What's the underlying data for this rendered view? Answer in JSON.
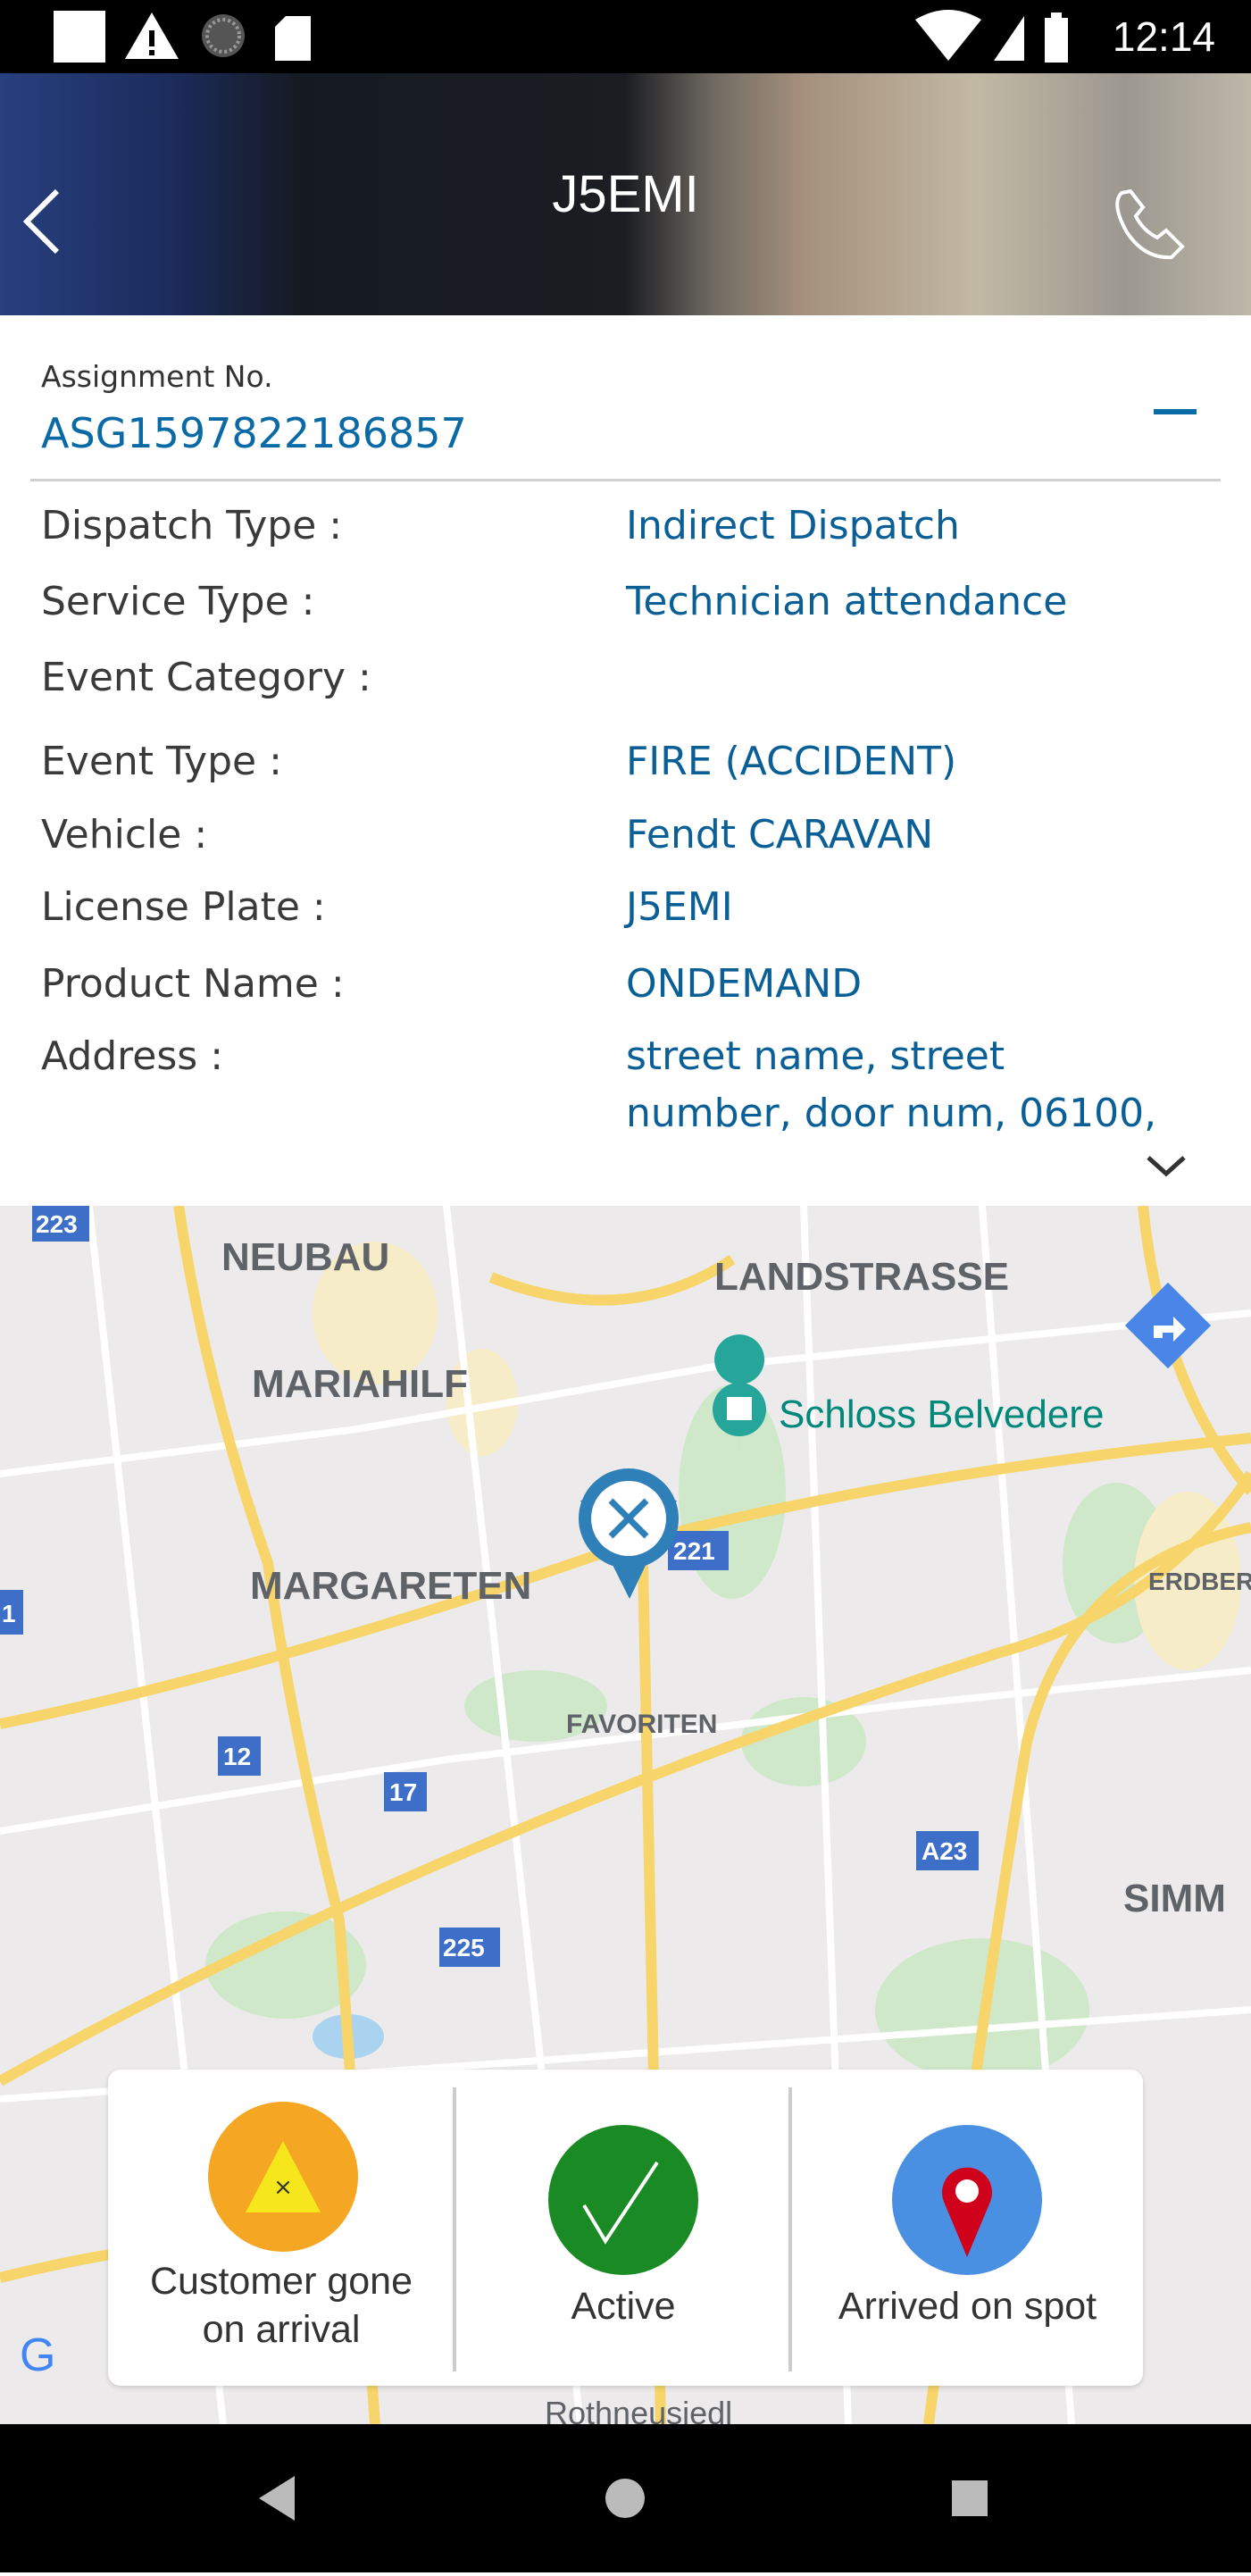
{
  "status_bar": {
    "time": "12:14"
  },
  "header": {
    "title": "J5EMI"
  },
  "assignment": {
    "label": "Assignment No.",
    "number": "ASG1597822186857"
  },
  "details": [
    {
      "label": "Dispatch Type :",
      "value": "Indirect Dispatch"
    },
    {
      "label": "Service Type :",
      "value": "Technician attendance"
    },
    {
      "label": "Event Category :",
      "value": ""
    },
    {
      "label": "Event Type :",
      "value": "FIRE (ACCIDENT)"
    },
    {
      "label": "Vehicle :",
      "value": "Fendt CARAVAN"
    },
    {
      "label": "License Plate :",
      "value": "J5EMI"
    },
    {
      "label": "Product Name :",
      "value": "ONDEMAND"
    },
    {
      "label": "Address :",
      "value": "street name, street"
    },
    {
      "label": "",
      "value": "number, door num, 06100,"
    }
  ],
  "map": {
    "labels": [
      "NEUBAU",
      "LANDSTRASSE",
      "MARIAHILF",
      "Schloss Belvedere",
      "MARGARETEN",
      "FAVORITEN",
      "ERDBER",
      "SIMM",
      "Rothneusiedl"
    ],
    "shields": [
      "223",
      "221",
      "1",
      "12",
      "17",
      "A23",
      "225"
    ],
    "logo": "Google"
  },
  "actions": [
    {
      "label_line1": "Customer gone",
      "label_line2": "on arrival",
      "color": "#f5a623"
    },
    {
      "label": "Active",
      "color": "#1a8a24"
    },
    {
      "label": "Arrived on spot",
      "color": "#4a90e2"
    }
  ]
}
